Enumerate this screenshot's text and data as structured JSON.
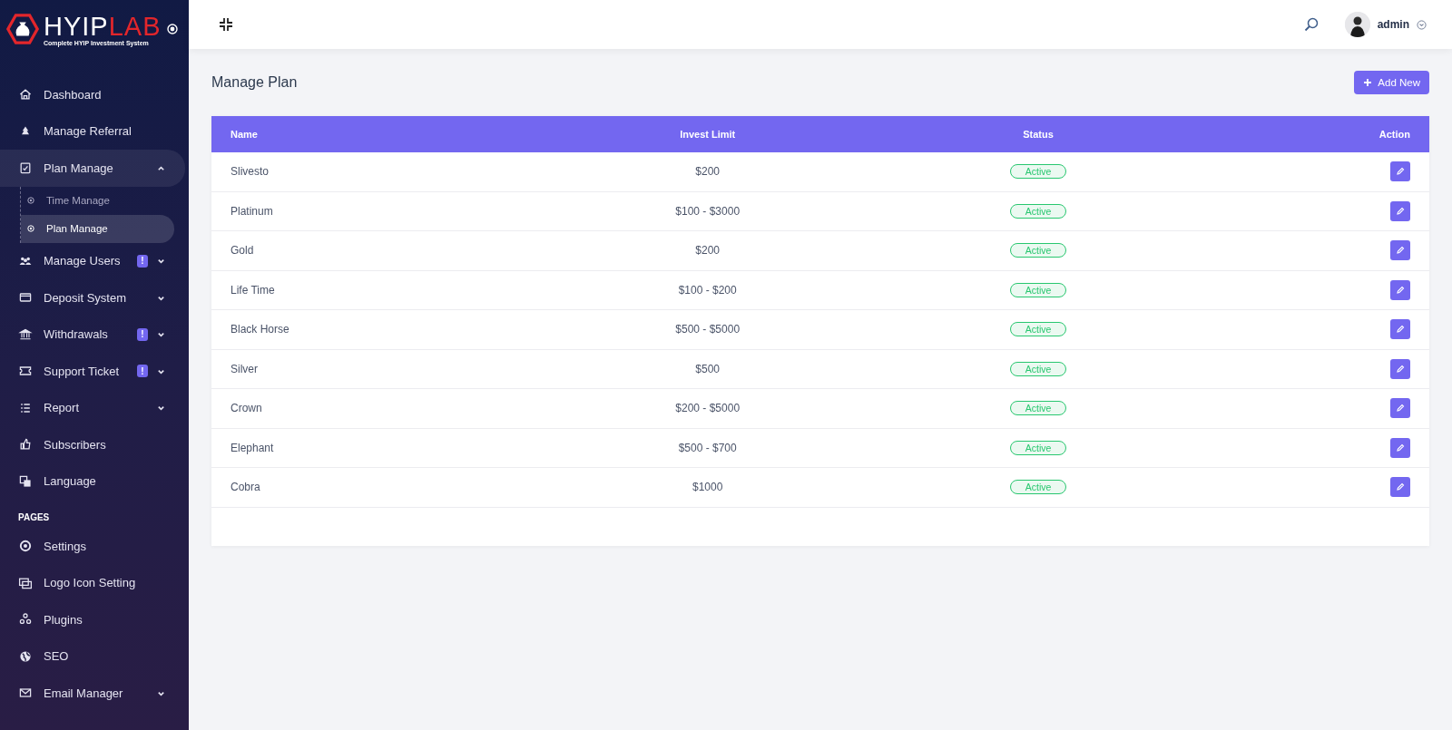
{
  "logo": {
    "name_start": "HYIP",
    "name_end": "LAB",
    "tagline": "Complete HYIP Investment System"
  },
  "sidebar": {
    "items": [
      {
        "kind": "item",
        "label": "Dashboard",
        "selected": false
      },
      {
        "kind": "item",
        "label": "Manage Referral",
        "selected": false
      },
      {
        "kind": "item",
        "label": "Plan Manage",
        "selected": false,
        "expanded": true,
        "children": [
          {
            "label": "Time Manage",
            "selected": false
          },
          {
            "label": "Plan Manage",
            "selected": true
          }
        ]
      },
      {
        "kind": "item",
        "label": "Manage Users",
        "selected": false,
        "expanded": false,
        "badge": "!"
      },
      {
        "kind": "item",
        "label": "Deposit System",
        "selected": false,
        "expanded": false
      },
      {
        "kind": "item",
        "label": "Withdrawals",
        "selected": false,
        "expanded": false,
        "badge": "!"
      },
      {
        "kind": "item",
        "label": "Support Ticket",
        "selected": false,
        "expanded": false,
        "badge": "!"
      },
      {
        "kind": "item",
        "label": "Report",
        "selected": false,
        "expanded": false
      },
      {
        "kind": "item",
        "label": "Subscribers",
        "selected": false
      },
      {
        "kind": "item",
        "label": "Language",
        "selected": false
      },
      {
        "kind": "section",
        "label": "PAGES"
      },
      {
        "kind": "item",
        "label": "Settings",
        "selected": false
      },
      {
        "kind": "item",
        "label": "Logo Icon Setting",
        "selected": false
      },
      {
        "kind": "item",
        "label": "Plugins",
        "selected": false
      },
      {
        "kind": "item",
        "label": "SEO",
        "selected": false
      },
      {
        "kind": "item",
        "label": "Email Manager",
        "selected": false,
        "expanded": false
      }
    ]
  },
  "header": {
    "user": "admin"
  },
  "page": {
    "title": "Manage Plan",
    "add_button": "Add New"
  },
  "table": {
    "columns": [
      "Name",
      "Invest Limit",
      "Status",
      "Action"
    ],
    "rows": [
      {
        "name": "Slivesto",
        "invest_limit": "$200",
        "status": "Active",
        "active": true
      },
      {
        "name": "Platinum",
        "invest_limit": "$100 - $3000",
        "status": "Active",
        "active": true
      },
      {
        "name": "Gold",
        "invest_limit": "$200",
        "status": "Active",
        "active": true
      },
      {
        "name": "Life Time",
        "invest_limit": "$100 - $200",
        "status": "Active",
        "active": true
      },
      {
        "name": "Black Horse",
        "invest_limit": "$500 - $5000",
        "status": "Active",
        "active": true
      },
      {
        "name": "Silver",
        "invest_limit": "$500",
        "status": "Active",
        "active": true
      },
      {
        "name": "Crown",
        "invest_limit": "$200 - $5000",
        "status": "Active",
        "active": true
      },
      {
        "name": "Elephant",
        "invest_limit": "$500 - $700",
        "status": "Active",
        "active": true
      },
      {
        "name": "Cobra",
        "invest_limit": "$1000",
        "status": "Active",
        "active": true
      }
    ]
  }
}
